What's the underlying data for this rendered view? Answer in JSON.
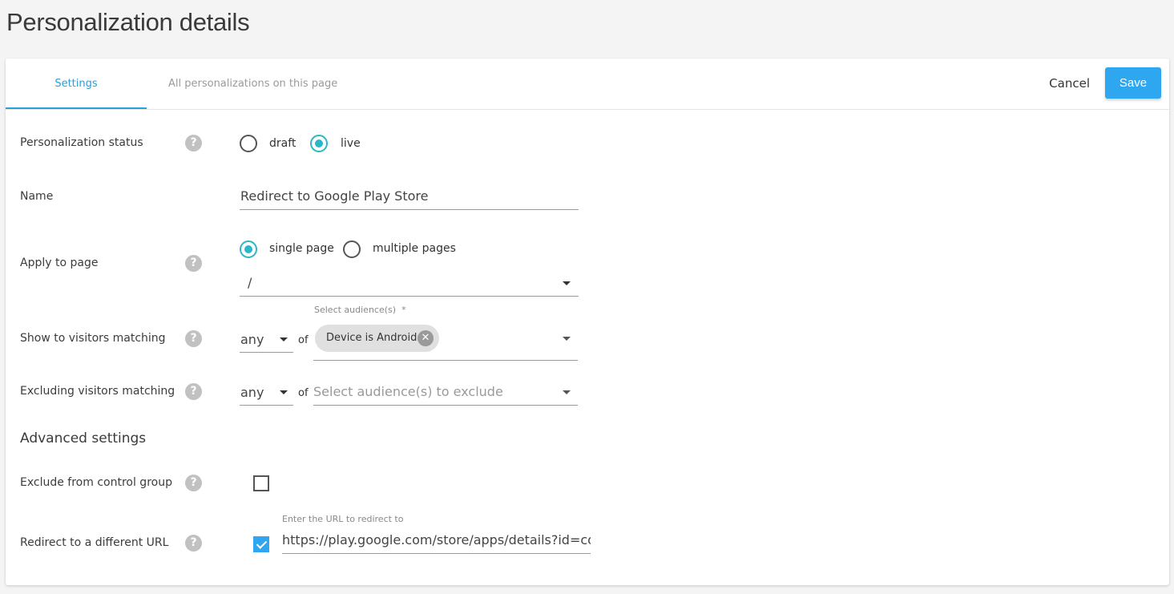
{
  "page_title": "Personalization details",
  "tabs": {
    "settings": "Settings",
    "all": "All personalizations on this page"
  },
  "actions": {
    "cancel": "Cancel",
    "save": "Save"
  },
  "fields": {
    "status": {
      "label": "Personalization status",
      "options": [
        "draft",
        "live"
      ],
      "selected": "live"
    },
    "name": {
      "label": "Name",
      "value": "Redirect to Google Play Store"
    },
    "apply": {
      "label": "Apply to page",
      "options": [
        "single page",
        "multiple pages"
      ],
      "selected": "single page",
      "page_value": "/"
    },
    "show": {
      "label": "Show to visitors matching",
      "match": "any",
      "of": "of",
      "audience_label": "Select audience(s)",
      "required_mark": "*",
      "chip": "Device is Android"
    },
    "exclude": {
      "label": "Excluding visitors matching",
      "match": "any",
      "of": "of",
      "placeholder": "Select audience(s) to exclude"
    }
  },
  "advanced": {
    "title": "Advanced settings",
    "control_group": {
      "label": "Exclude from control group",
      "checked": false
    },
    "redirect": {
      "label": "Redirect to a different URL",
      "checked": true,
      "url_label": "Enter the URL to redirect to",
      "url_value": "https://play.google.com/store/apps/details?id=com.n"
    }
  },
  "help_glyph": "?",
  "chip_remove_glyph": "✕",
  "colors": {
    "accent": "#2a9fd8",
    "radio": "#2bb7c7",
    "save_button": "#2ea7f0"
  }
}
